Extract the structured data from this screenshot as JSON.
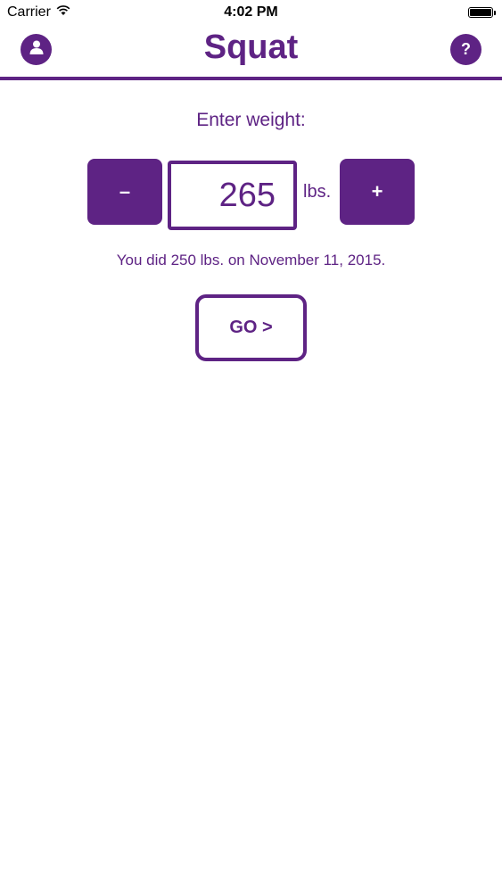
{
  "status_bar": {
    "carrier": "Carrier",
    "time": "4:02 PM",
    "battery_level": 1.0
  },
  "nav": {
    "title": "Squat",
    "left_icon": "user-icon",
    "right_icon": "help-icon",
    "help_label": "?"
  },
  "main": {
    "enter_label": "Enter weight:",
    "minus_label": "–",
    "plus_label": "+",
    "weight_value": "265",
    "unit": "lbs.",
    "history_text": "You did 250 lbs. on November 11, 2015.",
    "go_label": "GO >"
  },
  "colors": {
    "accent": "#5e2384",
    "background": "#ffffff"
  }
}
